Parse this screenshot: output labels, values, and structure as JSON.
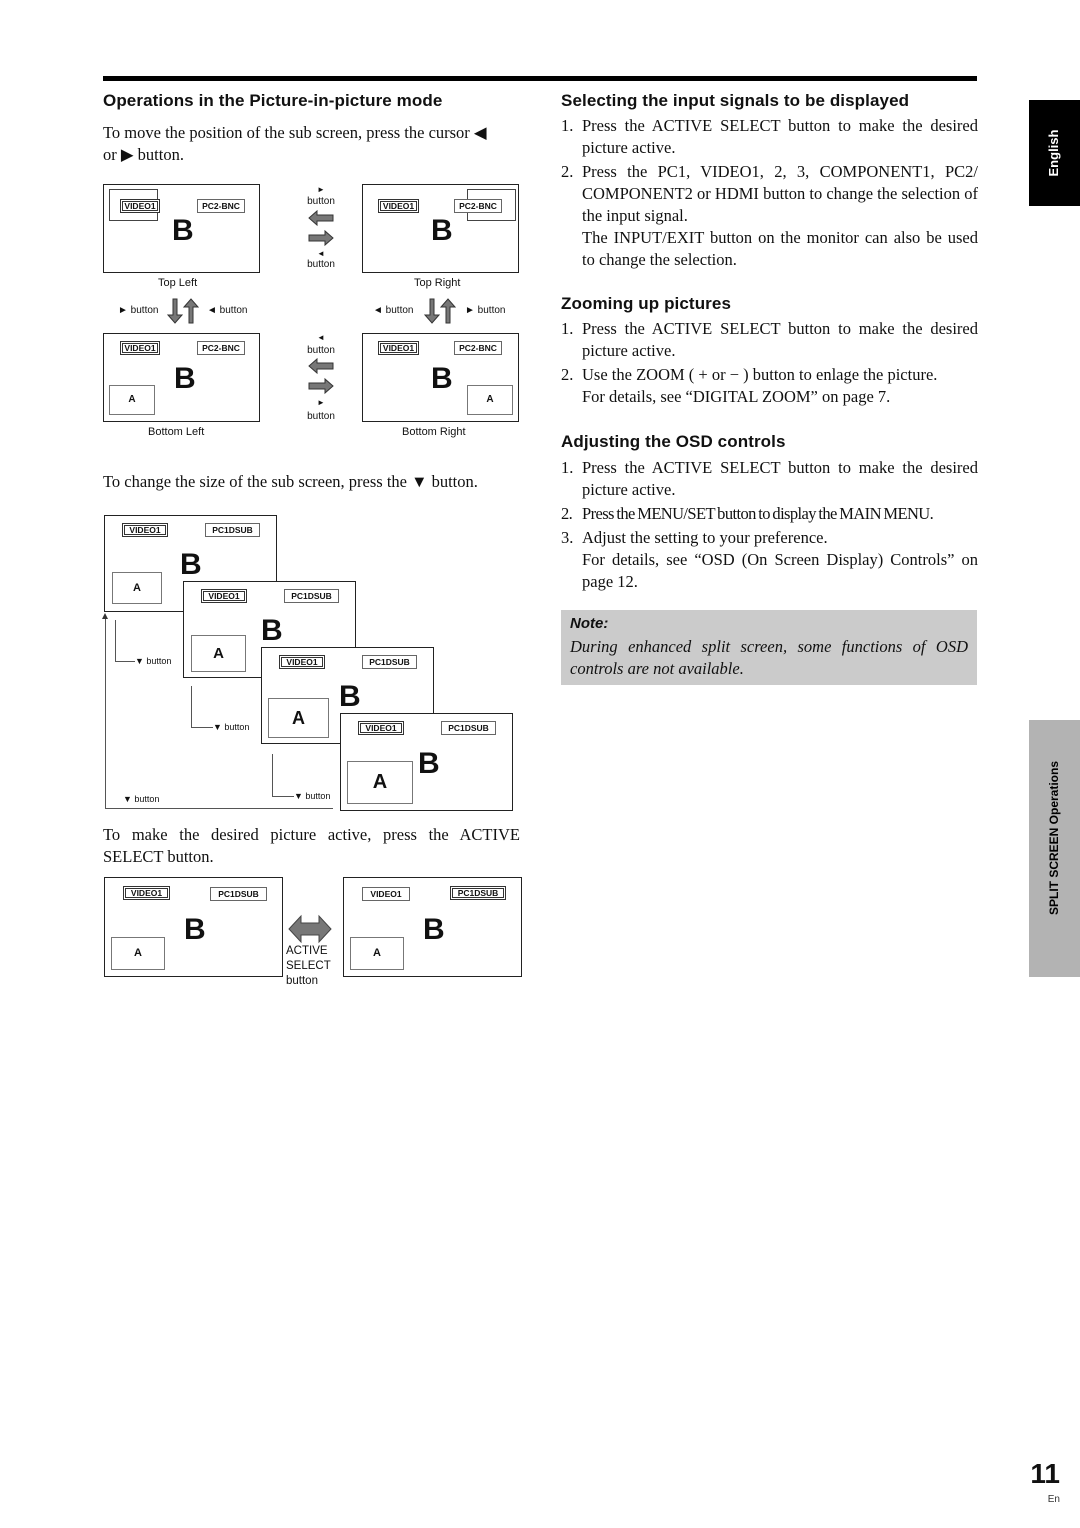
{
  "page": {
    "number": "11",
    "lang_code": "En",
    "side_tabs": {
      "language": "English",
      "section": "SPLIT SCREEN Operations"
    }
  },
  "left": {
    "pip_heading": "Operations in the Picture-in-picture mode",
    "move_text_1": "To move the position of the sub screen, press the cursor ◀",
    "move_text_2": "or ▶ button.",
    "size_text": "To change the size of the sub screen, press the ▼ button.",
    "active_text_1": "To make the desired picture active, press the ACTIVE",
    "active_text_2": "SELECT button."
  },
  "diagrams": {
    "screen_labels": {
      "video": "VIDEO1",
      "pc2": "PC2-BNC",
      "pc1": "PC1DSUB",
      "main": "B",
      "sub": "A"
    },
    "positions": {
      "top_left": "Top Left",
      "top_right": "Top Right",
      "bottom_left": "Bottom Left",
      "bottom_right": "Bottom Right"
    },
    "button_right": "► button",
    "button_left": "◄ button",
    "button_down": "▼ button",
    "button_word": "button",
    "arrow_right_glyph": "►",
    "arrow_left_glyph": "◄",
    "active_select": [
      "ACTIVE",
      "SELECT",
      "button"
    ]
  },
  "right": {
    "sections": [
      {
        "heading": "Selecting the input signals to be displayed",
        "items": [
          {
            "n": "1.",
            "text": "Press the ACTIVE SELECT button to make the desired picture active."
          },
          {
            "n": "2.",
            "text": "Press the PC1, VIDEO1, 2, 3, COMPONENT1, PC2/ COMPONENT2 or HDMI button to change the selection of the input signal.",
            "extra": "The INPUT/EXIT button on the monitor can also be used to change the selection."
          }
        ]
      },
      {
        "heading": "Zooming up pictures",
        "items": [
          {
            "n": "1.",
            "text": "Press the ACTIVE SELECT button to make the desired picture active."
          },
          {
            "n": "2.",
            "text": "Use the ZOOM ( + or − ) button to enlage the picture.",
            "extra": "For details, see “DIGITAL ZOOM” on page 7."
          }
        ]
      },
      {
        "heading": "Adjusting the OSD controls",
        "items": [
          {
            "n": "1.",
            "text": "Press the ACTIVE SELECT button to make the desired picture active."
          },
          {
            "n": "2.",
            "text": "Press the MENU/SET button to display the MAIN MENU."
          },
          {
            "n": "3.",
            "text": "Adjust the setting to your preference.",
            "extra": "For details, see “OSD (On Screen Display) Controls” on page 12."
          }
        ]
      }
    ],
    "note": {
      "title": "Note:",
      "text": "During enhanced split screen, some functions of OSD controls are not available."
    }
  }
}
